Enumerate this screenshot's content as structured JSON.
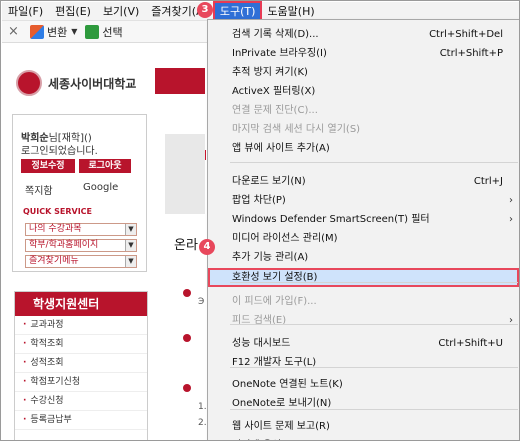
{
  "menubar": {
    "items": [
      "파일(F)",
      "편집(E)",
      "보기(V)",
      "즐겨찾기(A)",
      "도구(T)",
      "도움말(H)"
    ],
    "active_index": 4
  },
  "badges": {
    "step3": "3",
    "step4": "4"
  },
  "toolbar": {
    "close_glyph": "×",
    "convert_label": "변환",
    "select_label": "선택"
  },
  "page": {
    "university": "세종사이버대학교",
    "login": {
      "name": "박희순",
      "name_suffix": "님[재학]()",
      "status": "로그인되었습니다.",
      "btn_info": "정보수정",
      "btn_logout": "로그아웃",
      "link_note": "쪽지함",
      "link_google": "Google"
    },
    "quick_service": {
      "title": "QUICK SERVICE",
      "selects": [
        "나의 수강과목",
        "학부/학과홈페이지",
        "즐겨찾기메뉴"
      ]
    },
    "student_center": {
      "title": "학생지원센터",
      "items": [
        "교과과정",
        "학적조회",
        "성적조회",
        "학점포기신청",
        "수강신청",
        "등록금납부"
      ]
    },
    "center_text": "온라",
    "snippets": [
      "Э",
      "1.",
      "2."
    ]
  },
  "dropdown": {
    "items": [
      {
        "label": "검색 기록 삭제(D)...",
        "shortcut": "Ctrl+Shift+Del",
        "disabled": false
      },
      {
        "label": "InPrivate 브라우징(I)",
        "shortcut": "Ctrl+Shift+P",
        "disabled": false
      },
      {
        "label": "추적 방지 켜기(K)",
        "shortcut": "",
        "disabled": false
      },
      {
        "label": "ActiveX 필터링(X)",
        "shortcut": "",
        "disabled": false
      },
      {
        "label": "연결 문제 진단(C)...",
        "shortcut": "",
        "disabled": true
      },
      {
        "label": "마지막 검색 세션 다시 열기(S)",
        "shortcut": "",
        "disabled": true
      },
      {
        "label": "앱 뷰에 사이트 추가(A)",
        "shortcut": "",
        "disabled": false
      },
      {
        "label": "다운로드 보기(N)",
        "shortcut": "Ctrl+J",
        "disabled": false
      },
      {
        "label": "팝업 차단(P)",
        "shortcut": "",
        "disabled": false,
        "submenu": true
      },
      {
        "label": "Windows Defender SmartScreen(T) 필터",
        "shortcut": "",
        "disabled": false,
        "submenu": true
      },
      {
        "label": "미디어 라이선스 관리(M)",
        "shortcut": "",
        "disabled": false
      },
      {
        "label": "추가 기능 관리(A)",
        "shortcut": "",
        "disabled": false
      },
      {
        "label": "호환성 보기 설정(B)",
        "shortcut": "",
        "disabled": false,
        "highlight": true
      },
      {
        "label": "이 피드에 가입(F)...",
        "shortcut": "",
        "disabled": true
      },
      {
        "label": "피드 검색(E)",
        "shortcut": "",
        "disabled": true,
        "submenu": true
      },
      {
        "label": "성능 대시보드",
        "shortcut": "Ctrl+Shift+U",
        "disabled": false
      },
      {
        "label": "F12 개발자 도구(L)",
        "shortcut": "",
        "disabled": false
      },
      {
        "label": "OneNote 연결된 노트(K)",
        "shortcut": "",
        "disabled": false
      },
      {
        "label": "OneNote로 보내기(N)",
        "shortcut": "",
        "disabled": false
      },
      {
        "label": "웹 사이트 문제 보고(R)",
        "shortcut": "",
        "disabled": false
      },
      {
        "label": "인터넷 옵션(O)",
        "shortcut": "",
        "disabled": false
      }
    ],
    "submenu_glyph": "›"
  },
  "colors": {
    "accent": "#2f6fd6",
    "highlight_border": "#e8485c",
    "highlight_fill": "#cfe3fb",
    "brand_red": "#b8142c"
  }
}
